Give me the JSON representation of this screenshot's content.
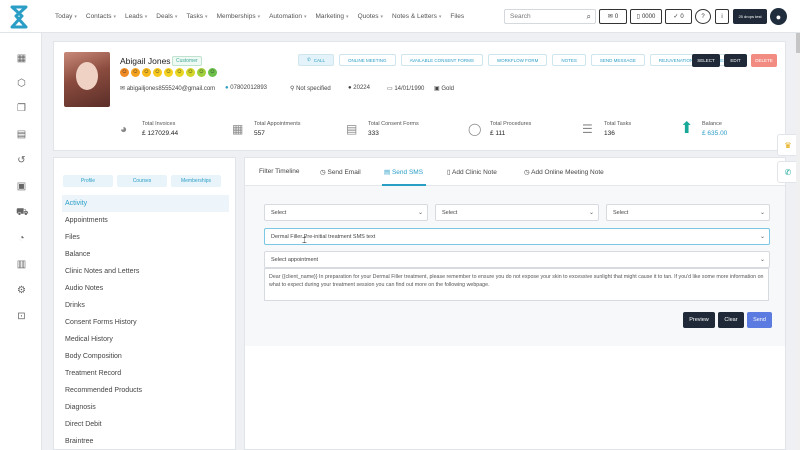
{
  "nav": {
    "items": [
      "Today",
      "Contacts",
      "Leads",
      "Deals",
      "Tasks",
      "Memberships",
      "Automation",
      "Marketing",
      "Quotes",
      "Notes & Letters",
      "Files"
    ],
    "search_placeholder": "Search",
    "badge_msg": "0",
    "badge_phone": "0000",
    "badge_check": "0",
    "badge_help": "?",
    "badge_info": "i",
    "dark_btn": "25 drops test"
  },
  "profile": {
    "name": "Abigail Jones",
    "tag": "Customer",
    "email": "abigailjones8555240@gmail.com",
    "phone": "07802012893",
    "location": "Not specified",
    "points": "20224",
    "dob": "14/01/1990",
    "tier": "Gold",
    "buttons": [
      "CALL",
      "ONLINE MEETING",
      "AVAILABLE CONSENT FORMS",
      "WORKFLOW FORM",
      "NOTES",
      "SEND MESSAGE",
      "REJUVENATION PROCEDURES"
    ],
    "actions": {
      "select": "SELECT",
      "edit": "EDIT",
      "delete": "DELETE"
    },
    "smileys": [
      "#f08a24",
      "#f4a11d",
      "#f6b81a",
      "#f7c81c",
      "#f4d11e",
      "#e9d621",
      "#d2d526",
      "#9fcf3a",
      "#6cc04a"
    ]
  },
  "stats": [
    {
      "label": "Total Invoices",
      "value": "£ 127029.44",
      "icon": "piggy-bank-icon"
    },
    {
      "label": "Total Appointments",
      "value": "557",
      "icon": "calendar-icon"
    },
    {
      "label": "Total Consent Forms",
      "value": "333",
      "icon": "document-icon"
    },
    {
      "label": "Total Procedures",
      "value": "£ 111",
      "icon": "procedure-icon"
    },
    {
      "label": "Total Tasks",
      "value": "136",
      "icon": "task-list-icon"
    },
    {
      "label": "Balance",
      "value": "£ 635.00",
      "icon": "arrow-up-icon"
    }
  ],
  "left": {
    "tabs": [
      "Profile",
      "Courses",
      "Memberships"
    ],
    "menu": [
      "Activity",
      "Appointments",
      "Files",
      "Balance",
      "Clinic Notes and Letters",
      "Audio Notes",
      "Drinks",
      "Consent Forms History",
      "Medical History",
      "Body Composition",
      "Treatment Record",
      "Recommended Products",
      "Diagnosis",
      "Direct Debit",
      "Braintree"
    ]
  },
  "right": {
    "tabs": [
      "Filter Timeline",
      "Send Email",
      "Send SMS",
      "Add Clinic Note",
      "Add Online Meeting Note"
    ],
    "select1": "Select",
    "select2": "Select",
    "select3": "Select",
    "template": "Dermal Filler Pre-initial treatment SMS text",
    "appointment": "Select appointment",
    "message": "Dear {{client_name}} In preparation for your Dermal Filler treatment, please remember to ensure you do not expose your skin to excessive sunlight that might cause it to tan. If you'd like some more information on what to expect during your treatment session you can find out more on the following webpage.",
    "preview": "Preview",
    "clear": "Clear",
    "send": "Send"
  },
  "colors": {
    "accent": "#2b9ec6",
    "dark": "#1f2937",
    "delete": "#f28b82",
    "send": "#5b7be0",
    "arrow": "#17a89a"
  }
}
